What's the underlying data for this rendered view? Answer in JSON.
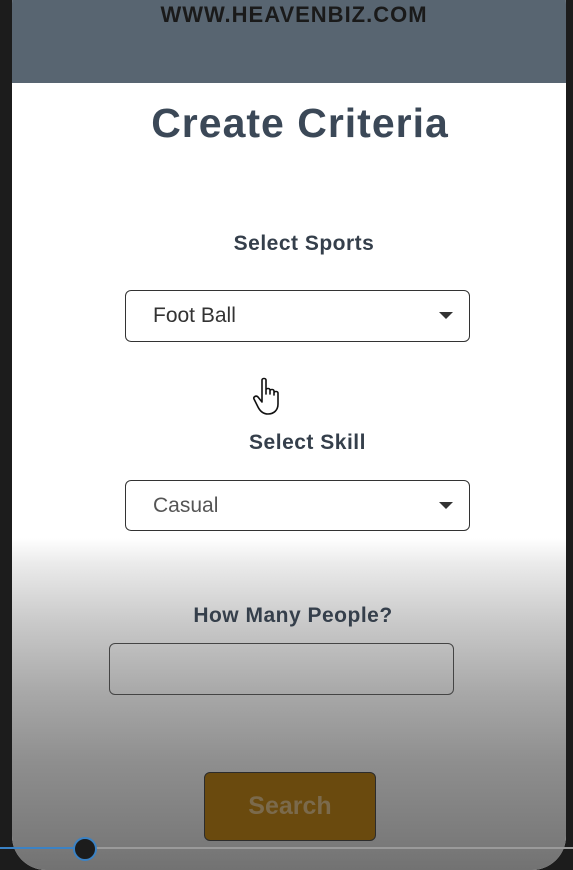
{
  "header": {
    "banner_text": "WWW.HEAVENBIZ.COM"
  },
  "page": {
    "title": "Create Criteria"
  },
  "form": {
    "sports_label": "Select Sports",
    "sports_value": "Foot Ball",
    "skill_label": "Select Skill",
    "skill_value": "Casual",
    "people_label": "How Many People?",
    "people_value": "",
    "search_label": "Search"
  },
  "icons": {
    "cursor": "hand-pointer-icon",
    "dropdown": "chevron-down-icon"
  },
  "colors": {
    "header": "#586571",
    "title": "#3b4857",
    "search_button": "#6a4a0e",
    "scrubber_accent": "#3b82c4"
  },
  "video": {
    "progress": 0.15
  }
}
